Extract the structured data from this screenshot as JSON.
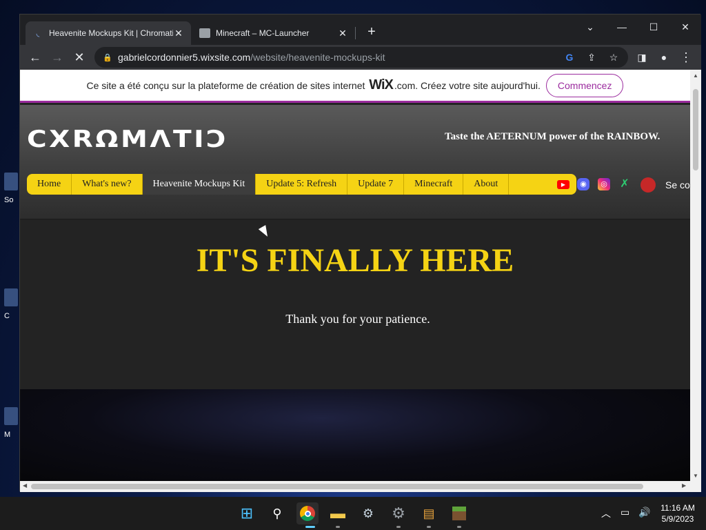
{
  "desktop": {
    "icons": [
      {
        "label": "So"
      },
      {
        "label": "C"
      },
      {
        "label": "M"
      }
    ]
  },
  "browser": {
    "tabs": [
      {
        "title": "Heavenite Mockups Kit | Chromatic",
        "active": true
      },
      {
        "title": "Minecraft – MC-Launcher",
        "active": false
      }
    ],
    "url_host": "gabrielcordonnier5.wixsite.com",
    "url_path": "/website/heavenite-mockups-kit"
  },
  "wix_banner": {
    "text_before": "Ce site a été conçu sur la plateforme de création de sites internet",
    "brand": "WiX",
    "text_after": ".com. Créez votre site aujourd'hui.",
    "button": "Commencez"
  },
  "site": {
    "logo": "CXRΩMΛTIƆ",
    "tagline": "Taste the AETERNUM power of the RAINBOW.",
    "nav": [
      {
        "label": "Home"
      },
      {
        "label": "What's new?"
      },
      {
        "label": "Heavenite Mockups Kit",
        "active": true
      },
      {
        "label": "Update 5: Refresh"
      },
      {
        "label": "Update 7"
      },
      {
        "label": "Minecraft"
      },
      {
        "label": "About"
      }
    ],
    "login_label": "Se co",
    "hero_title": "IT'S FINALLY HERE",
    "hero_subtitle": "Thank you for your patience."
  },
  "taskbar": {
    "time": "11:16 AM",
    "date": "5/9/2023"
  },
  "colors": {
    "accent_yellow": "#f5d314",
    "wix_purple": "#9b2b9e"
  }
}
